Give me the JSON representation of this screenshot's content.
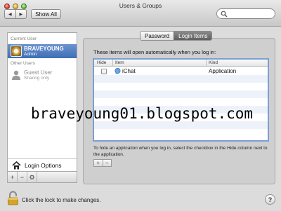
{
  "window": {
    "title": "Users & Groups",
    "back_label": "◀",
    "forward_label": "▶",
    "show_all_label": "Show All",
    "search_placeholder": ""
  },
  "sidebar": {
    "current_user_header": "Current User",
    "current_user": {
      "name": "BRAVEYOUNG",
      "role": "Admin"
    },
    "other_users_header": "Other Users",
    "other_users": [
      {
        "name": "Guest User",
        "role": "Sharing only"
      }
    ],
    "login_options_label": "Login Options",
    "toolbar": {
      "add": "+",
      "remove": "−",
      "gear": "⚙"
    }
  },
  "tabs": [
    {
      "label": "Password",
      "active": false
    },
    {
      "label": "Login Items",
      "active": true
    }
  ],
  "login_items": {
    "description": "These items will open automatically when you log in:",
    "columns": {
      "hide": "Hide",
      "item": "Item",
      "kind": "Kind"
    },
    "rows": [
      {
        "hide": false,
        "item": "iChat",
        "icon": "ichat-icon",
        "kind": "Application"
      }
    ],
    "hint": "To hide an application when you log in, select the checkbox in the Hide column next to the application.",
    "add": "+",
    "remove": "−"
  },
  "watermark": "braveyoung01.blogspot.com",
  "footer": {
    "lock_text": "Click the lock to make changes.",
    "help": "?"
  },
  "colors": {
    "selection": "#3d6fb6",
    "table_focus": "#7b9fd4",
    "row_alt": "#edf2fa"
  }
}
